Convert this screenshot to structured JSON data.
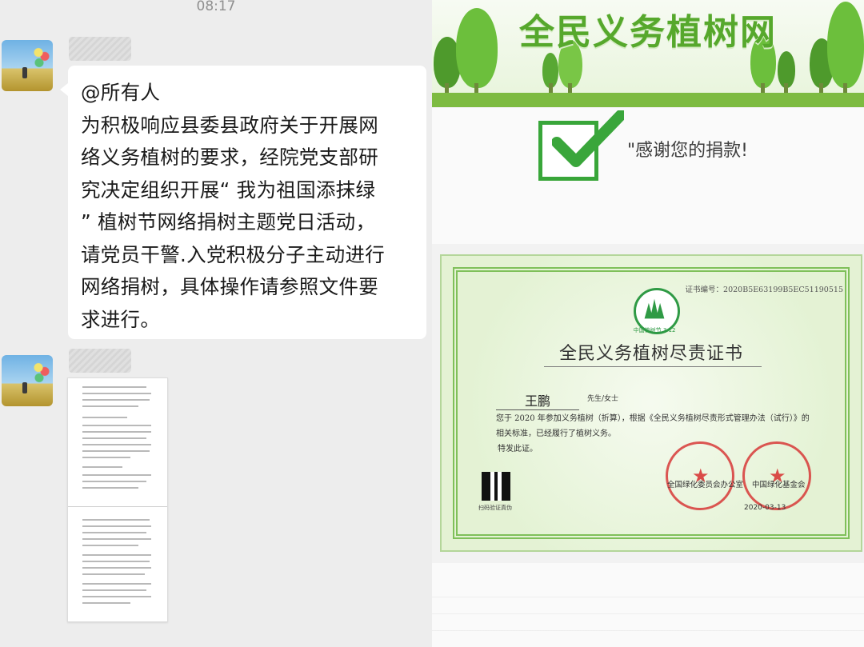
{
  "chat": {
    "time": "08:17",
    "message": "@所有人\n为积极响应县委县政府关于开展网\n络义务植树的要求，经院党支部研\n究决定组织开展“ 我为祖国添抹绿\n” 植树节网络捐树主题党日活动，\n请党员干警.入党积极分子主动进行\n网络捐树，具体操作请参照文件要\n求进行。"
  },
  "site": {
    "banner_title": "全民义务植树网",
    "thanks": "\"感谢您的捐款!",
    "accent_green": "#56a82c"
  },
  "certificate": {
    "number": "证书编号：2020B5E63199B5EC51190515",
    "logo_caption": "中国植树节 3·12",
    "title": "全民义务植树尽责证书",
    "name": "王鹏",
    "salutation": "先生/女士",
    "body": "您于 2020 年参加义务植树（折算），根据《全民义务植树尽责形式管理办法（试行）》的相关标准，已经履行了植树义务。",
    "closing": "特发此证。",
    "qr_label": "扫码验证真伪",
    "issuer_left": "全国绿化委员会办公室",
    "issuer_right": "中国绿化基金会",
    "date": "2020-03-13"
  }
}
